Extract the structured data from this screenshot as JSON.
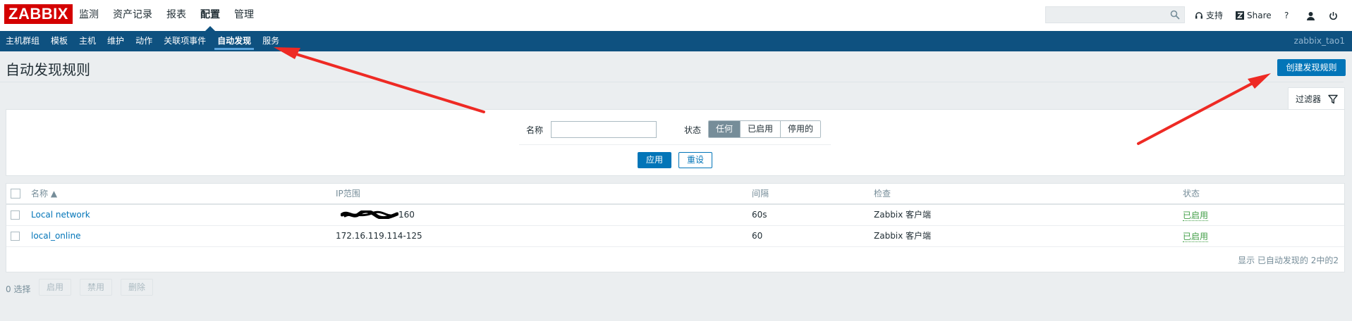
{
  "header": {
    "logo": "ZABBIX",
    "nav": [
      "监测",
      "资产记录",
      "报表",
      "配置",
      "管理"
    ],
    "active_nav_index": 3,
    "search_placeholder": "",
    "support": "支持",
    "share": "Share",
    "help": "?"
  },
  "subnav": {
    "items": [
      "主机群组",
      "模板",
      "主机",
      "维护",
      "动作",
      "关联项事件",
      "自动发现",
      "服务"
    ],
    "active_index": 6,
    "username": "zabbix_tao1"
  },
  "page": {
    "title": "自动发现规则",
    "create_button": "创建发现规则"
  },
  "filter": {
    "tab_label": "过滤器",
    "name_label": "名称",
    "name_value": "",
    "status_label": "状态",
    "status_options": [
      "任何",
      "已启用",
      "停用的"
    ],
    "status_selected": "任何",
    "apply": "应用",
    "reset": "重设"
  },
  "table": {
    "columns": [
      "名称 ▲",
      "IP范围",
      "间隔",
      "检查",
      "状态"
    ],
    "rows": [
      {
        "name": "Local network",
        "ip_range": "160",
        "interval": "60s",
        "checks": "Zabbix 客户端",
        "status": "已启用"
      },
      {
        "name": "local_online",
        "ip_range": "172.16.119.114-125",
        "interval": "60",
        "checks": "Zabbix 客户端",
        "status": "已启用"
      }
    ],
    "footer": "显示 已自动发现的 2中的2"
  },
  "mass_actions": {
    "selected": "0 选择",
    "enable": "启用",
    "disable": "禁用",
    "delete": "删除"
  },
  "colors": {
    "brand_red": "#d40000",
    "subnav_bg": "#0e5180",
    "primary_blue": "#0275b8",
    "enabled_green": "#429e47",
    "annotation_arrow": "#ee2a24"
  }
}
